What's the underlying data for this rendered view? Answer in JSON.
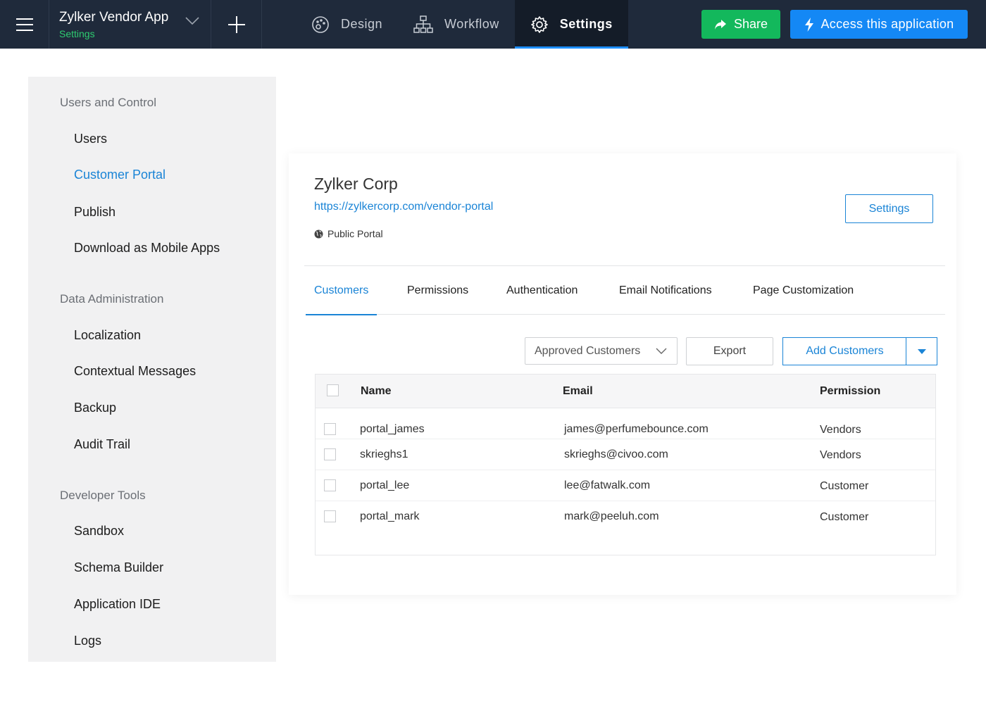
{
  "header": {
    "app_name": "Zylker Vendor App",
    "app_subtitle": "Settings",
    "tabs": [
      {
        "label": "Design",
        "icon": "palette-icon"
      },
      {
        "label": "Workflow",
        "icon": "workflow-icon"
      },
      {
        "label": "Settings",
        "icon": "gear-icon",
        "active": true
      }
    ],
    "share_label": "Share",
    "access_label": "Access this application",
    "colors": {
      "bar": "#1f2a3b",
      "share": "#13b85c",
      "access": "#1488f5",
      "accent": "#1e8fff",
      "subtitle": "#2ecc71"
    }
  },
  "sidebar": {
    "sections": [
      {
        "title": "Users and Control",
        "items": [
          "Users",
          "Customer Portal",
          "Publish",
          "Download as Mobile Apps"
        ]
      },
      {
        "title": "Data Administration",
        "items": [
          "Localization",
          "Contextual Messages",
          "Backup",
          "Audit Trail"
        ]
      },
      {
        "title": "Developer Tools",
        "items": [
          "Sandbox",
          "Schema Builder",
          "Application IDE",
          "Logs"
        ]
      }
    ],
    "active_item": "Customer Portal"
  },
  "portal": {
    "name": "Zylker Corp",
    "url": "https://zylkercorp.com/vendor-portal",
    "type": "Public Portal",
    "settings_label": "Settings"
  },
  "tabs": [
    "Customers",
    "Permissions",
    "Authentication",
    "Email Notifications",
    "Page Customization"
  ],
  "active_tab": "Customers",
  "toolbar": {
    "filter_value": "Approved Customers",
    "export_label": "Export",
    "add_label": "Add Customers"
  },
  "table": {
    "columns": [
      "Name",
      "Email",
      "Permission"
    ],
    "rows": [
      {
        "name": "portal_james",
        "email": "james@perfumebounce.com",
        "permission": "Vendors"
      },
      {
        "name": "skrieghs1",
        "email": "skrieghs@civoo.com",
        "permission": "Vendors"
      },
      {
        "name": "portal_lee",
        "email": "lee@fatwalk.com",
        "permission": "Customer"
      },
      {
        "name": "portal_mark",
        "email": "mark@peeluh.com",
        "permission": "Customer"
      }
    ]
  }
}
